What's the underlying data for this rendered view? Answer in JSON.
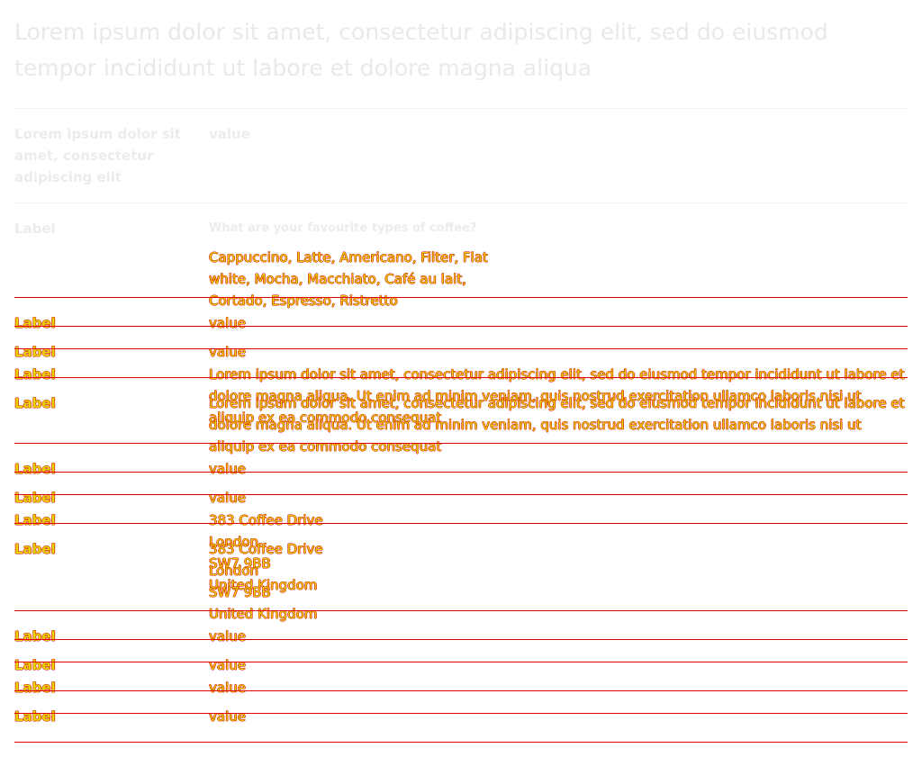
{
  "page_title": "Lorem ipsum dolor sit amet, consectetur adipiscing elit, sed do eiusmod tempor incididunt ut labore et dolore magna aliqua",
  "summary_header": {
    "key": "Lorem ipsum dolor sit amet, consectetur adipiscing elit",
    "value": "value"
  },
  "question_row": {
    "key": "Label",
    "question": "What are your favourite types of coffee?",
    "answer": "Cappuccino, Latte, Americano, Filter, Flat white, Mocha, Macchiato, Café au lait, Cortado, Espresso, Ristretto"
  },
  "rows": [
    {
      "key": "Label",
      "value": "value"
    },
    {
      "key": "Label",
      "value": "value"
    },
    {
      "key": "Label",
      "value": "Lorem ipsum dolor sit amet, consectetur adipiscing elit, sed do eiusmod tempor incididunt ut labore et dolore magna aliqua. Ut enim ad minim veniam, quis nostrud exercitation ullamco laboris nisi ut aliquip ex ea commodo consequat"
    },
    {
      "key": "Label",
      "value": "Lorem ipsum dolor sit amet, consectetur adipiscing elit, sed do eiusmod tempor incididunt ut labore et dolore magna aliqua. Ut enim ad minim veniam, quis nostrud exercitation ullamco laboris nisi ut aliquip ex ea commodo consequat"
    },
    {
      "key": "Label",
      "value": "value"
    },
    {
      "key": "Label",
      "value": "value"
    },
    {
      "key": "Label",
      "address": [
        "383 Coffee Drive",
        "London",
        "SW7 9BB",
        "United Kingdom"
      ]
    },
    {
      "key": "Label",
      "address": [
        "383 Coffee Drive",
        "London",
        "SW7 9BB",
        "United Kingdom"
      ]
    },
    {
      "key": "Label",
      "value": "value"
    },
    {
      "key": "Label",
      "value": "value"
    },
    {
      "key": "Label",
      "value": "value"
    },
    {
      "key": "Label",
      "value": "value"
    }
  ]
}
